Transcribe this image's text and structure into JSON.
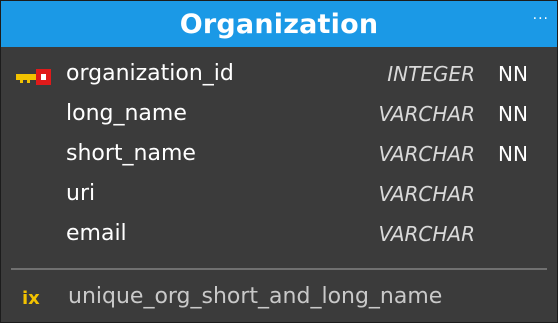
{
  "table": {
    "title": "Organization",
    "menu_icon": "ellipsis-icon",
    "menu_label": "···",
    "header_color": "#1b99e6",
    "columns": [
      {
        "name": "organization_id",
        "type": "INTEGER",
        "nn": "NN",
        "primary_key": true
      },
      {
        "name": "long_name",
        "type": "VARCHAR",
        "nn": "NN",
        "primary_key": false
      },
      {
        "name": "short_name",
        "type": "VARCHAR",
        "nn": "NN",
        "primary_key": false
      },
      {
        "name": "uri",
        "type": "VARCHAR",
        "nn": "",
        "primary_key": false
      },
      {
        "name": "email",
        "type": "VARCHAR",
        "nn": "",
        "primary_key": false
      }
    ],
    "pk_icon": "primary-key-icon",
    "index": {
      "icon": "index-icon",
      "icon_label": "ix",
      "name": "unique_org_short_and_long_name"
    }
  }
}
